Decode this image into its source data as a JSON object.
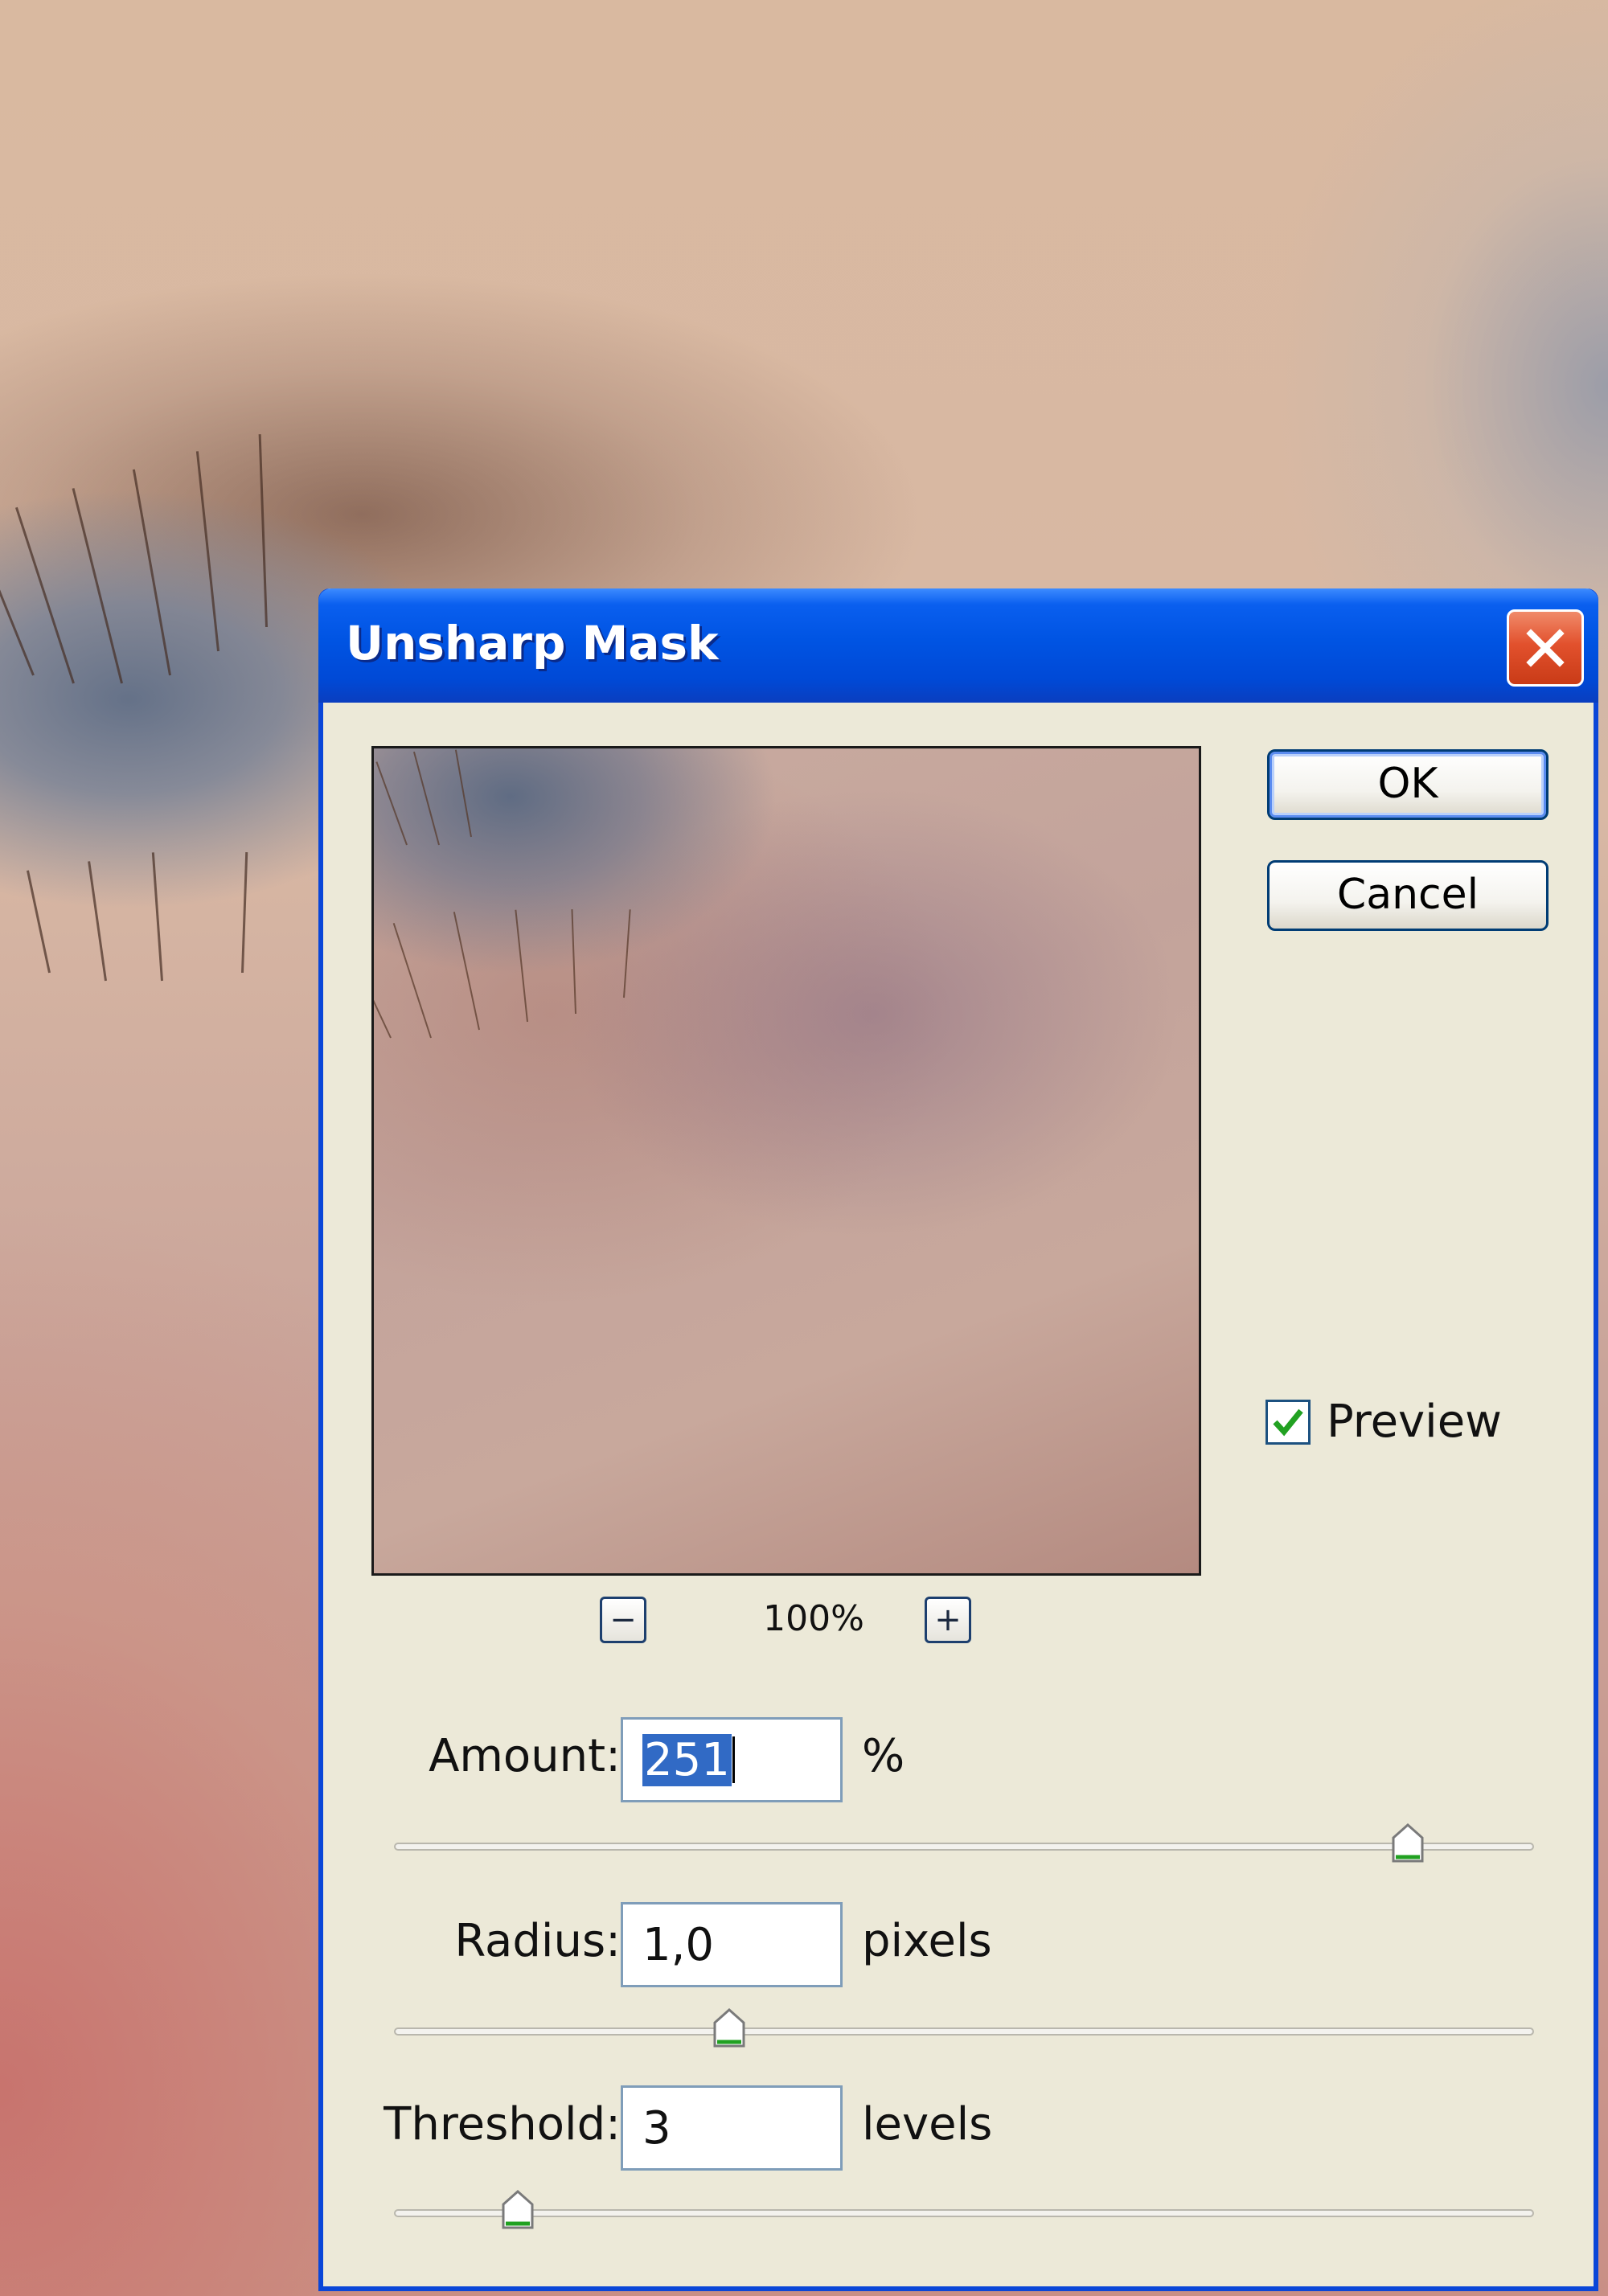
{
  "dialog": {
    "title": "Unsharp Mask",
    "close_icon": "close-icon",
    "preview_zoom": {
      "zoom_out_label": "−",
      "zoom_level": "100%",
      "zoom_in_label": "+"
    },
    "buttons": {
      "ok_label": "OK",
      "cancel_label": "Cancel"
    },
    "preview_checkbox": {
      "label": "Preview",
      "checked": true
    },
    "amount": {
      "label": "Amount:",
      "value": "251",
      "unit": "%",
      "slider_value": 251,
      "slider_range": [
        1,
        500
      ]
    },
    "radius": {
      "label": "Radius:",
      "value": "1,0",
      "unit": "pixels",
      "slider_value": 1.0,
      "slider_range": [
        0.1,
        250
      ]
    },
    "threshold": {
      "label": "Threshold:",
      "value": "3",
      "unit": "levels",
      "slider_value": 3,
      "slider_range": [
        0,
        255
      ]
    }
  },
  "colors": {
    "title_bar": "#0054e3",
    "dialog_bg": "#ece9d8",
    "selection": "#316ac5",
    "close_button": "#e2512d"
  }
}
